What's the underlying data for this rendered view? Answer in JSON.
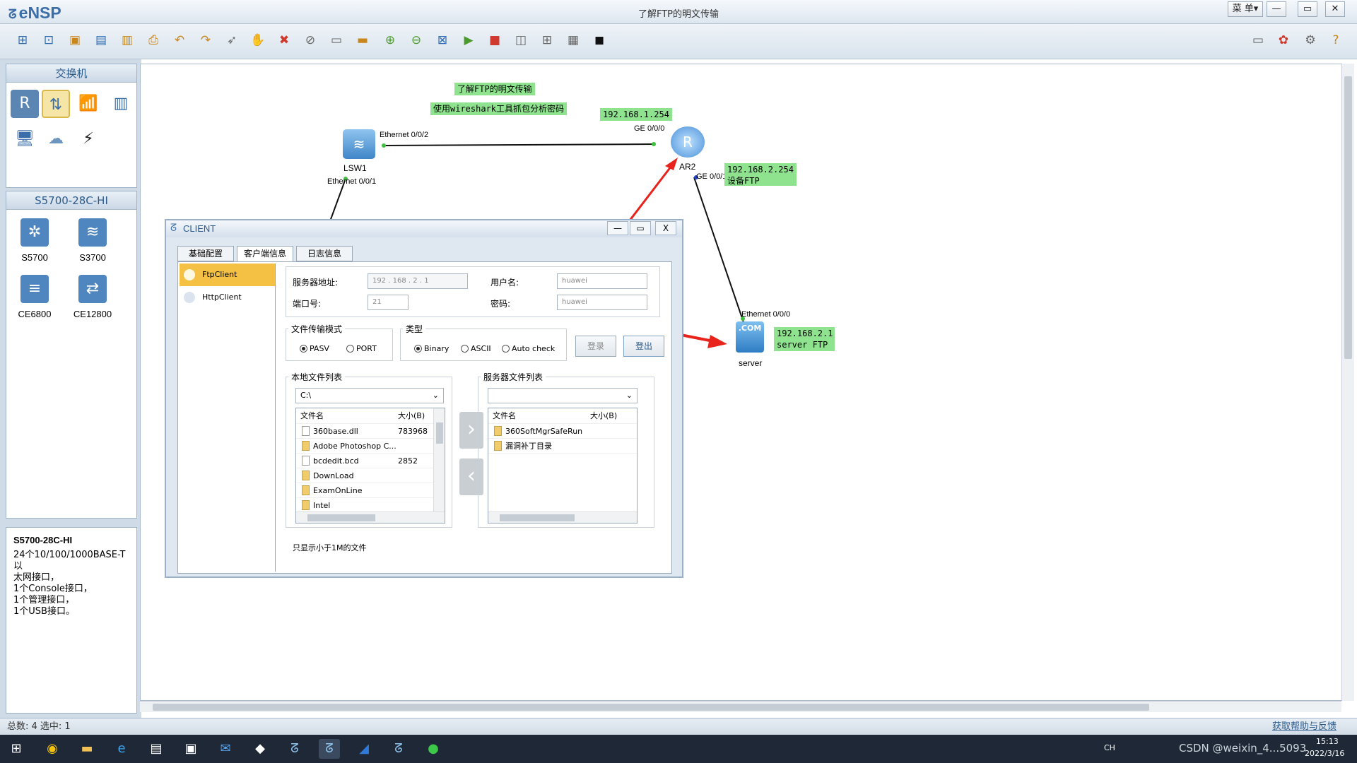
{
  "app": {
    "name": "eNSP",
    "window_title": "了解FTP的明文传输",
    "menu_label": "菜 单▾",
    "min_label": "—",
    "max_label": "▭",
    "close_label": "✕"
  },
  "toolbar_icons": [
    "new-topology-icon",
    "new-example-icon",
    "open-icon",
    "save-icon",
    "save-as-icon",
    "print-icon",
    "undo-icon",
    "redo-icon",
    "select-icon",
    "pan-icon",
    "delete-icon",
    "delete-link-icon",
    "text-icon",
    "palette-icon",
    "zoom-in-icon",
    "zoom-out-icon",
    "fit-icon",
    "start-all-icon",
    "stop-all-icon",
    "capture-icon",
    "topology-icon",
    "grid-icon",
    "cli-icon"
  ],
  "right_icons": [
    "chat-icon",
    "huawei-icon",
    "settings-icon",
    "help-icon"
  ],
  "left_panel": {
    "category_title": "交换机",
    "model_title": "S5700-28C-HI",
    "models": [
      {
        "label": "S5700"
      },
      {
        "label": "S3700"
      },
      {
        "label": "CE6800"
      },
      {
        "label": "CE12800"
      }
    ],
    "info_title": "S5700-28C-HI",
    "info_text": [
      "24个10/100/1000BASE-T以",
      "太网接口，",
      "1个Console接口，",
      "1个管理接口，",
      "1个USB接口。"
    ]
  },
  "topology": {
    "note_title": "了解FTP的明文传输",
    "note_subtitle": "使用wireshark工具抓包分析密码",
    "nodes": {
      "lsw1": "LSW1",
      "ar2": "AR2",
      "server": "server"
    },
    "ports": {
      "lsw1_e02": "Ethernet 0/0/2",
      "lsw1_e01": "Ethernet 0/0/1",
      "ar2_ge0": "GE 0/0/0",
      "ar2_ge1": "GE 0/0/1",
      "server_e0": "Ethernet 0/0/0"
    },
    "ip_labels": {
      "ar2_g0": "192.168.1.254",
      "ar2_g1": [
        "192.168.2.254",
        "设备FTP"
      ],
      "server": [
        "192.168.2.1",
        "server FTP"
      ]
    }
  },
  "dialog": {
    "title": "CLIENT",
    "min_label": "—",
    "max_label": "▭",
    "close_label": "X",
    "tabs": [
      "基础配置",
      "客户端信息",
      "日志信息"
    ],
    "active_tab_index": 1,
    "side_items": [
      "FtpClient",
      "HttpClient"
    ],
    "server_addr_label": "服务器地址:",
    "server_addr_octets": [
      "192",
      "168",
      "2",
      "1"
    ],
    "port_label": "端口号:",
    "port_value": "21",
    "user_label": "用户名:",
    "user_value": "huawei",
    "pass_label": "密码:",
    "pass_value": "huawei",
    "mode_group": "文件传输模式",
    "mode_options": [
      "PASV",
      "PORT"
    ],
    "mode_selected": "PASV",
    "type_group": "类型",
    "type_options": [
      "Binary",
      "ASCII",
      "Auto check"
    ],
    "type_selected": "Binary",
    "login_button": "登录",
    "logout_button": "登出",
    "local_group": "本地文件列表",
    "local_path": "C:\\",
    "server_group": "服务器文件列表",
    "server_path": "",
    "col_name": "文件名",
    "col_size": "大小(B)",
    "local_files": [
      {
        "name": "360base.dll",
        "size": "783968",
        "kind": "file"
      },
      {
        "name": "Adobe Photoshop C...",
        "size": "",
        "kind": "folder"
      },
      {
        "name": "bcdedit.bcd",
        "size": "2852",
        "kind": "file"
      },
      {
        "name": "DownLoad",
        "size": "",
        "kind": "folder"
      },
      {
        "name": "ExamOnLine",
        "size": "",
        "kind": "folder"
      },
      {
        "name": "Intel",
        "size": "",
        "kind": "folder"
      }
    ],
    "server_files": [
      {
        "name": "360SoftMgrSafeRun",
        "size": "",
        "kind": "folder"
      },
      {
        "name": "漏洞补丁目录",
        "size": "",
        "kind": "folder"
      }
    ],
    "upload_label": "›",
    "download_label": "‹",
    "filter_note": "只显示小于1M的文件"
  },
  "status": {
    "left": "总数: 4 选中: 1",
    "right": "获取帮助与反馈"
  },
  "taskbar": {
    "icons": [
      "windows-start-icon",
      "chrome-icon",
      "explorer-icon",
      "edge-icon",
      "app-icon",
      "ensp-app-icon",
      "mail-icon",
      "tool-icon",
      "ensp-icon",
      "ensp-active-icon",
      "wireshark-icon",
      "ensp-icon-2",
      "wechat-icon"
    ],
    "tray_text": "CH",
    "watermark": "CSDN @weixin_4...5093",
    "time": "15:13",
    "date": "2022/3/16"
  }
}
